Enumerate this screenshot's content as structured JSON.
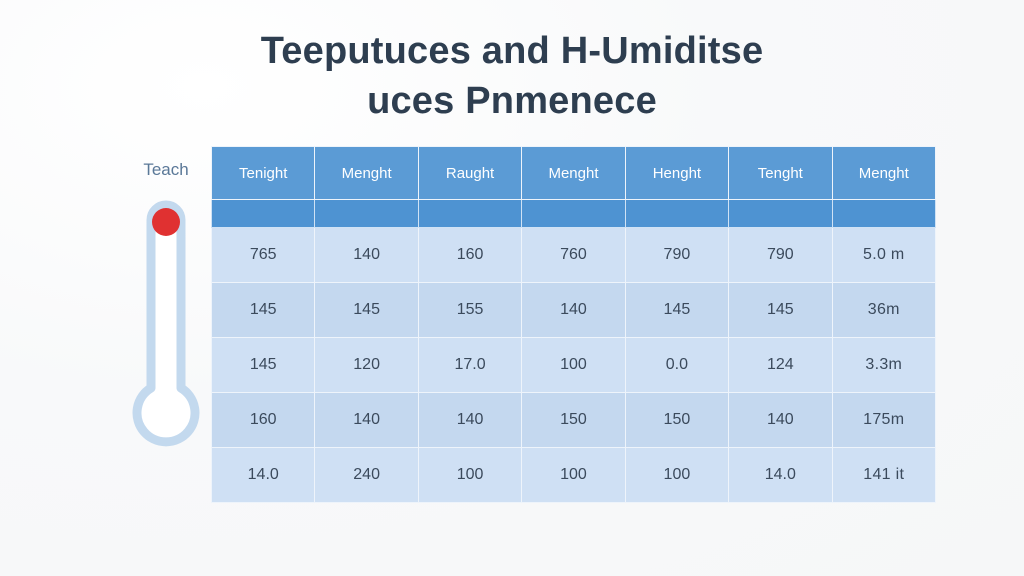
{
  "page": {
    "background_color": "#f9fafb",
    "title_color": "#2e3e50",
    "accent_color": "#5b9bd5",
    "title_lines": [
      "Teeputuces and H-Umiditse",
      "uces Pnmenece"
    ]
  },
  "thermometer": {
    "label": "Teach",
    "label_color": "#5a7898",
    "outline_color": "#c3d9ee",
    "bulb_fill": "#ffffff",
    "indicator_color": "#e03131",
    "icon": "thermometer-icon"
  },
  "table": {
    "header_background": "#5b9bd5",
    "header_text_color": "#ffffff",
    "row_odd_background": "#cfe0f4",
    "row_even_background": "#c4d8ef",
    "columns": [
      "Tenight",
      "Menght",
      "Raught",
      "Menght",
      "Henght",
      "Tenght",
      "Menght"
    ],
    "subheader_row_empty": true,
    "rows": [
      [
        "765",
        "140",
        "160",
        "760",
        "790",
        "790",
        "5.0 m"
      ],
      [
        "145",
        "145",
        "155",
        "140",
        "145",
        "145",
        "36m"
      ],
      [
        "145",
        "120",
        "17.0",
        "100",
        "0.0",
        "124",
        "3.3m"
      ],
      [
        "160",
        "140",
        "140",
        "150",
        "150",
        "140",
        "175m"
      ],
      [
        "14.0",
        "240",
        "100",
        "100",
        "100",
        "14.0",
        "141 it"
      ]
    ]
  }
}
